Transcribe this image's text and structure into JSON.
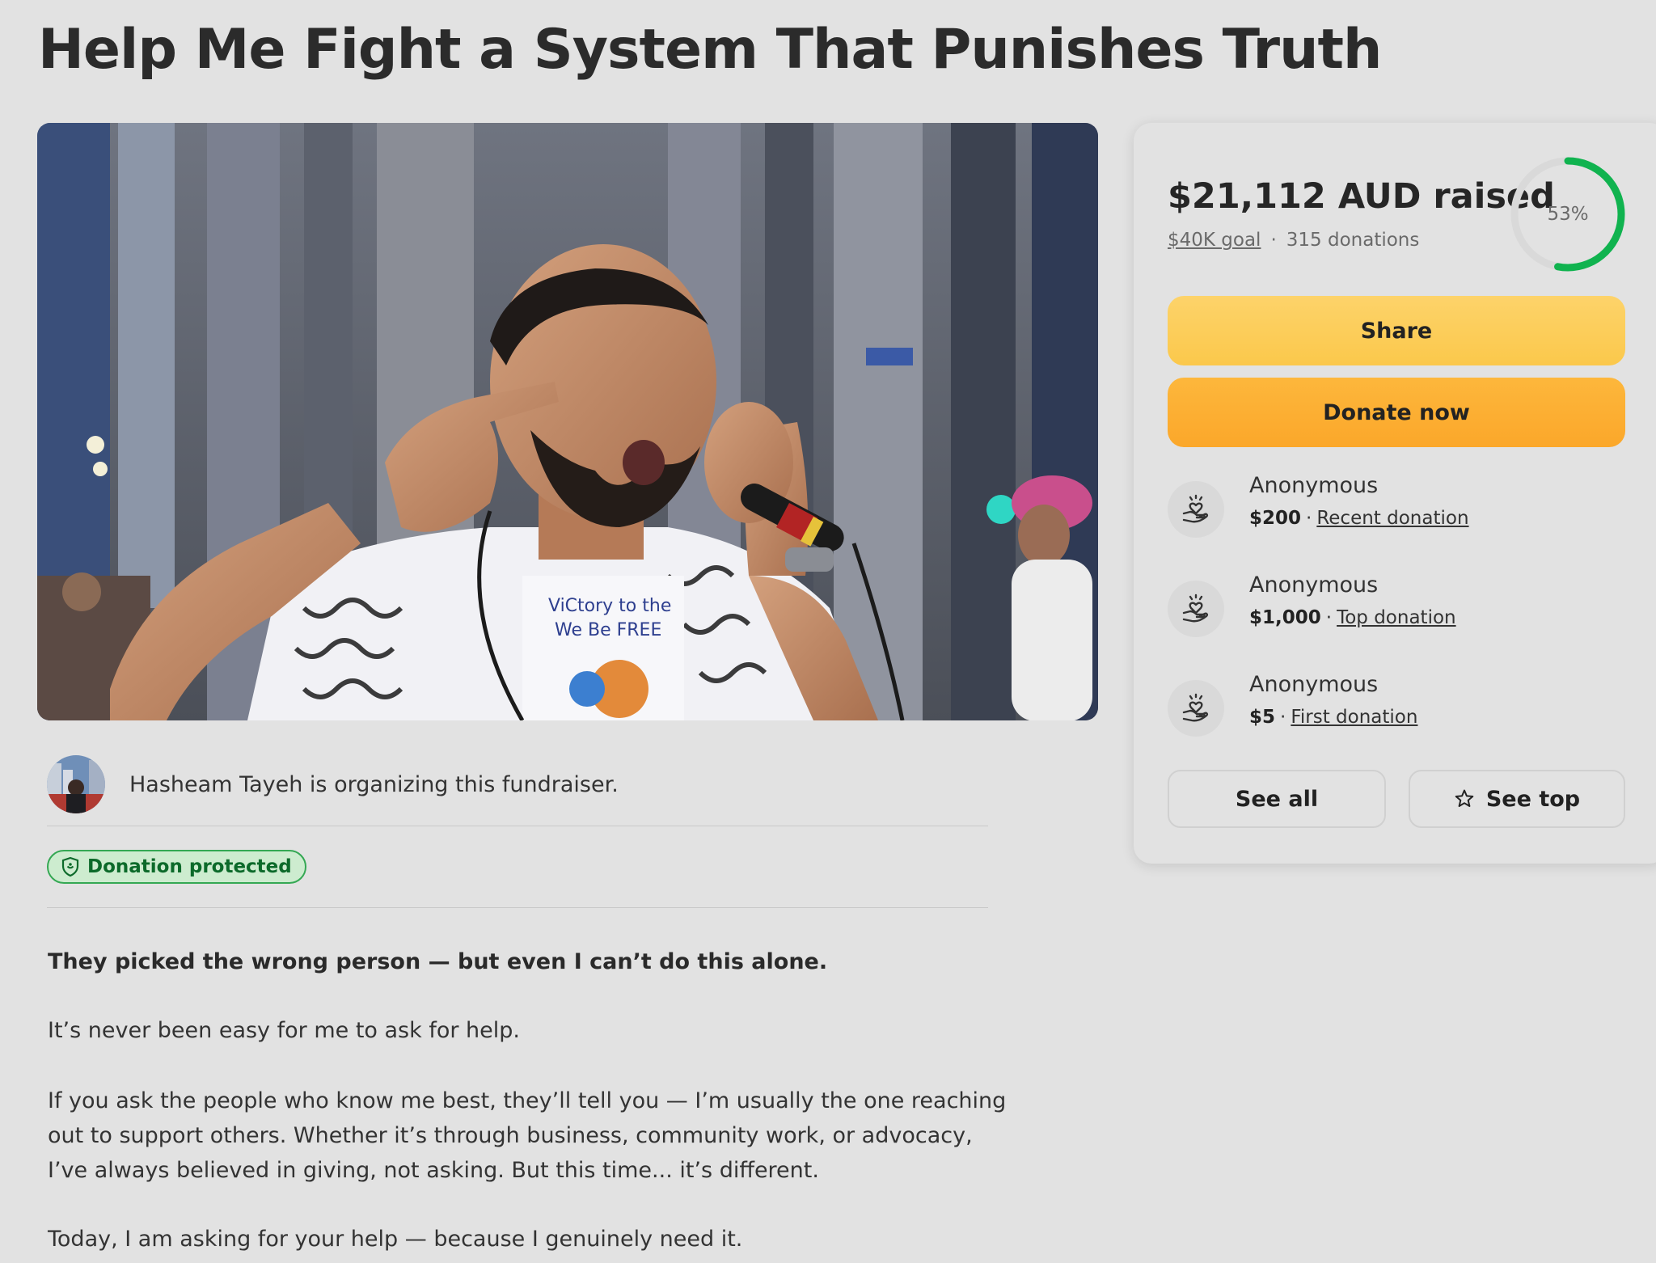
{
  "page": {
    "title": "Help Me Fight a System That Punishes Truth"
  },
  "hero": {
    "shirt_text_line1": "ViCtory to the",
    "shirt_text_line2": "We Be FREE"
  },
  "organizer": {
    "text": "Hasheam Tayeh is organizing this fundraiser."
  },
  "badge": {
    "label": "Donation protected",
    "color": "#34a853"
  },
  "story": {
    "lead": "They picked the wrong person — but even I can’t do this alone.",
    "paragraphs": [
      "It’s never been easy for me to ask for help.",
      "If you ask the people who know me best, they’ll tell you — I’m usually the one reaching out to support others. Whether it’s through business, community work, or advocacy, I’ve always believed in giving, not asking. But this time... it’s different.",
      "Today, I am asking for your help — because I genuinely need it."
    ]
  },
  "sidebar": {
    "raised": "$21,112 AUD raised",
    "goal": "$40K goal",
    "separator": "·",
    "donations_count": "315 donations",
    "progress_pct": 53,
    "progress_label": "53%",
    "progress_color": "#10b34f",
    "share_label": "Share",
    "donate_label": "Donate now",
    "share_color": "#fcc94c",
    "donate_color": "#fcab2d",
    "donations": [
      {
        "name": "Anonymous",
        "amount": "$200",
        "type": "Recent donation"
      },
      {
        "name": "Anonymous",
        "amount": "$1,000",
        "type": "Top donation"
      },
      {
        "name": "Anonymous",
        "amount": "$5",
        "type": "First donation"
      }
    ],
    "see_all_label": "See all",
    "see_top_label": "See top",
    "icons": {
      "donation": "heart-hand-icon",
      "see_top": "star-icon",
      "badge": "shield-icon"
    }
  }
}
